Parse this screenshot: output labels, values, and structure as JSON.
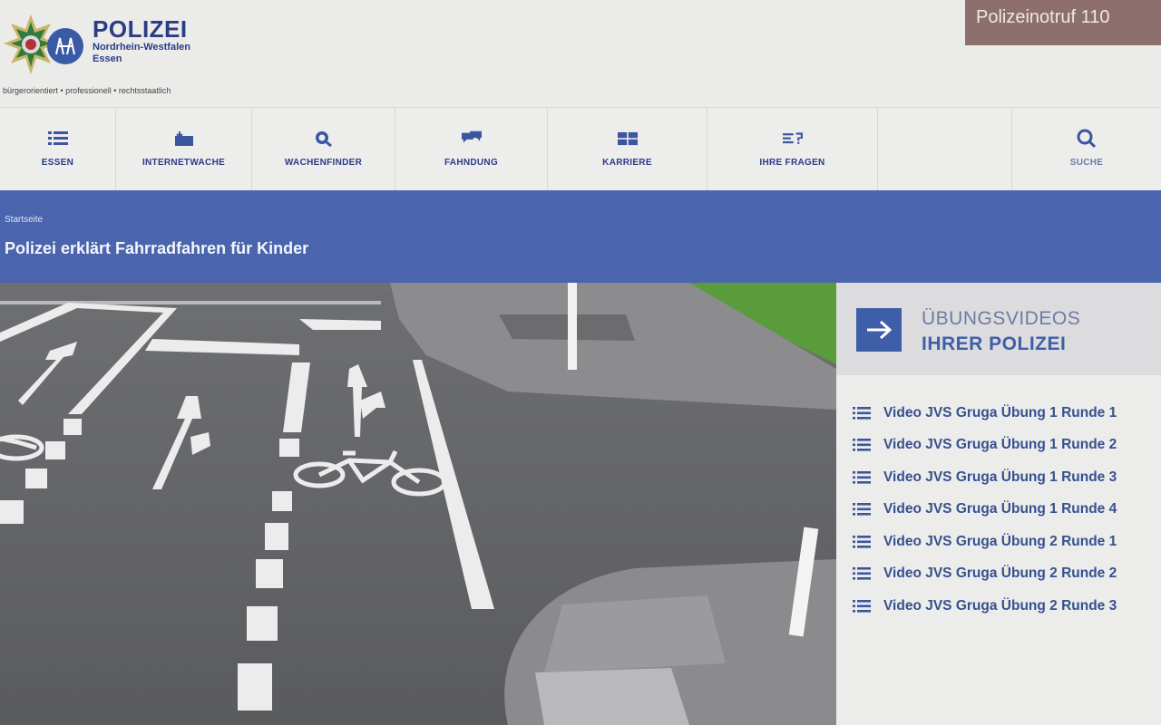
{
  "header": {
    "brand_title": "POLIZEI",
    "brand_state": "Nordrhein-Westfalen",
    "brand_city": "Essen",
    "tagline": "bürgerorientiert • professionell • rechtsstaatlich",
    "emergency_label": "Polizeinotruf 110"
  },
  "nav": {
    "items": [
      {
        "label": "ESSEN",
        "icon": "list-icon"
      },
      {
        "label": "INTERNETWACHE",
        "icon": "inbox-icon"
      },
      {
        "label": "WACHENFINDER",
        "icon": "map-search-icon"
      },
      {
        "label": "FAHNDUNG",
        "icon": "chat-icon"
      },
      {
        "label": "KARRIERE",
        "icon": "grid-icon"
      },
      {
        "label": "IHRE FRAGEN",
        "icon": "faq-icon"
      },
      {
        "label": "",
        "icon": ""
      },
      {
        "label": "SUCHE",
        "icon": "search-icon"
      }
    ]
  },
  "banner": {
    "breadcrumb": "Startseite",
    "title": "Polizei erklärt Fahrradfahren für Kinder"
  },
  "sidebar": {
    "heading_line1": "ÜBUNGSVIDEOS",
    "heading_line2": "IHRER POLIZEI",
    "videos": [
      "Video JVS Gruga Übung 1 Runde 1",
      "Video JVS Gruga Übung 1 Runde 2",
      "Video JVS Gruga Übung 1 Runde 3",
      "Video JVS Gruga Übung 1 Runde 4",
      "Video JVS Gruga Übung 2 Runde 1",
      "Video JVS Gruga Übung 2 Runde 2",
      "Video JVS Gruga Übung 2 Runde 3"
    ]
  },
  "colors": {
    "brand_blue": "#2b3c86",
    "banner_blue": "#4a65ad",
    "emergency_bg": "#8d6f6e"
  }
}
